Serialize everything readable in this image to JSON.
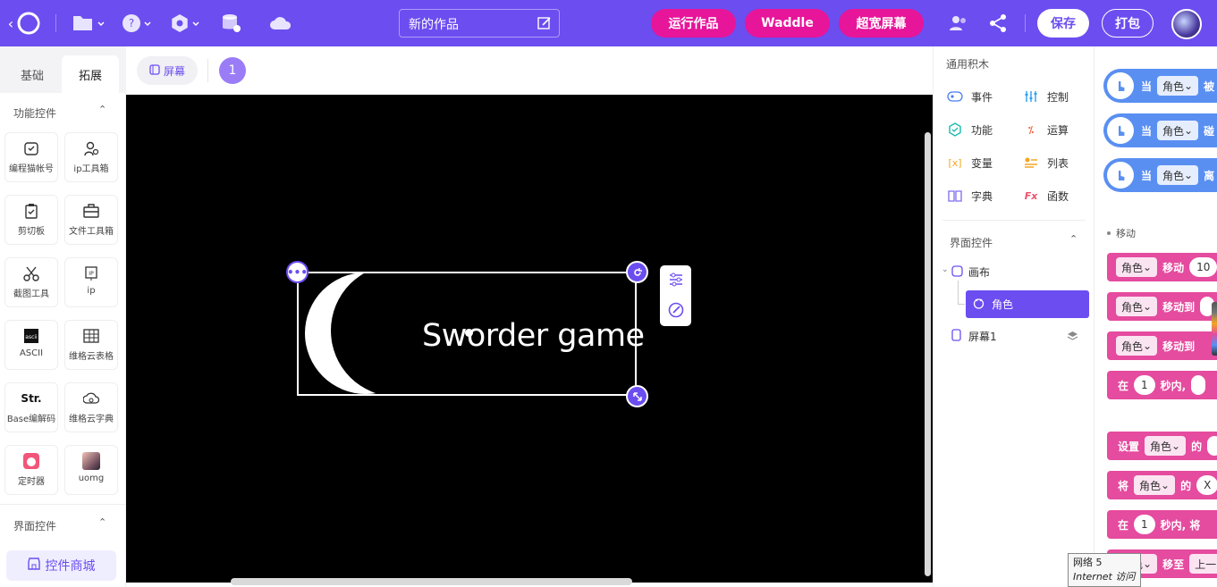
{
  "topbar": {
    "project_title": "新的作品",
    "run_label": "运行作品",
    "waddle_label": "Waddle",
    "wide_screen_label": "超宽屏幕",
    "save_label": "保存",
    "package_label": "打包"
  },
  "left": {
    "tabs": [
      "基础",
      "拓展"
    ],
    "section1": "功能控件",
    "section2": "界面控件",
    "tiles": [
      "编程猫帐号",
      "ip工具箱",
      "剪切板",
      "文件工具箱",
      "截图工具",
      "ip",
      "ASCII",
      "维格云表格",
      "Base编解码",
      "维格云字典",
      "定时器",
      "uomg"
    ],
    "shop_label": "控件商城"
  },
  "stagebar": {
    "screen_label": "屏幕",
    "screen_number": "1"
  },
  "stage": {
    "sprite_text": "Sworder game"
  },
  "categories": {
    "general_title": "通用积木",
    "items": [
      "事件",
      "控制",
      "功能",
      "运算",
      "变量",
      "列表",
      "字典",
      "函数"
    ],
    "ui_title": "界面控件",
    "tree": [
      "画布",
      "角色",
      "屏幕1"
    ]
  },
  "blocks": {
    "when": "当",
    "role": "角色",
    "evt_tails": [
      "被",
      "碰",
      "离"
    ],
    "move_section": "移动",
    "move": "移动",
    "move_val": "10",
    "move_to": "移动到",
    "in": "在",
    "one": "1",
    "seconds": "秒内,",
    "set": "设置",
    "of": "的",
    "will": "将",
    "x": "X",
    "sec_will": "秒内, 将",
    "move_to2": "移至",
    "up": "上一"
  },
  "tooltip": {
    "line1": "网络  5",
    "line2": "Internet 访问"
  },
  "colors": {
    "accent": "#6c4df0",
    "pink": "#e6159a",
    "block_pink": "#e54b9f",
    "event_blue": "#5a8ff2"
  }
}
